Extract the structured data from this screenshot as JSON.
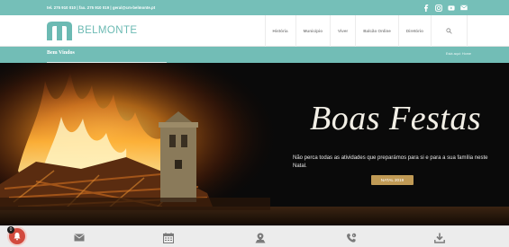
{
  "topbar": {
    "contact": "tel. 275 910 010 | fax. 275 910 019 | geral@cm-belmonte.pt",
    "social": [
      "facebook-icon",
      "instagram-icon",
      "youtube-icon",
      "mail-icon"
    ]
  },
  "header": {
    "logo_text": "BELMONTE",
    "nav": [
      "História",
      "Município",
      "Viver",
      "Balcão Online",
      "Diretório"
    ]
  },
  "subbar": {
    "title": "Bem Vindos",
    "breadcrumb": "Está aqui: Home"
  },
  "hero": {
    "title": "Boas Festas",
    "text": "Não perca todas as atividades que preparámos para si e para a sua família neste Natal.",
    "button": "NATAL 2019"
  },
  "bottombar": {
    "icons": [
      "envelope-icon",
      "calendar-icon",
      "map-pin-icon",
      "phone-icon",
      "download-icon"
    ]
  },
  "notification": {
    "count": "0"
  },
  "colors": {
    "teal": "#75bfb8",
    "gold_button": "#c09a55",
    "notification_red": "#d24a3e"
  }
}
